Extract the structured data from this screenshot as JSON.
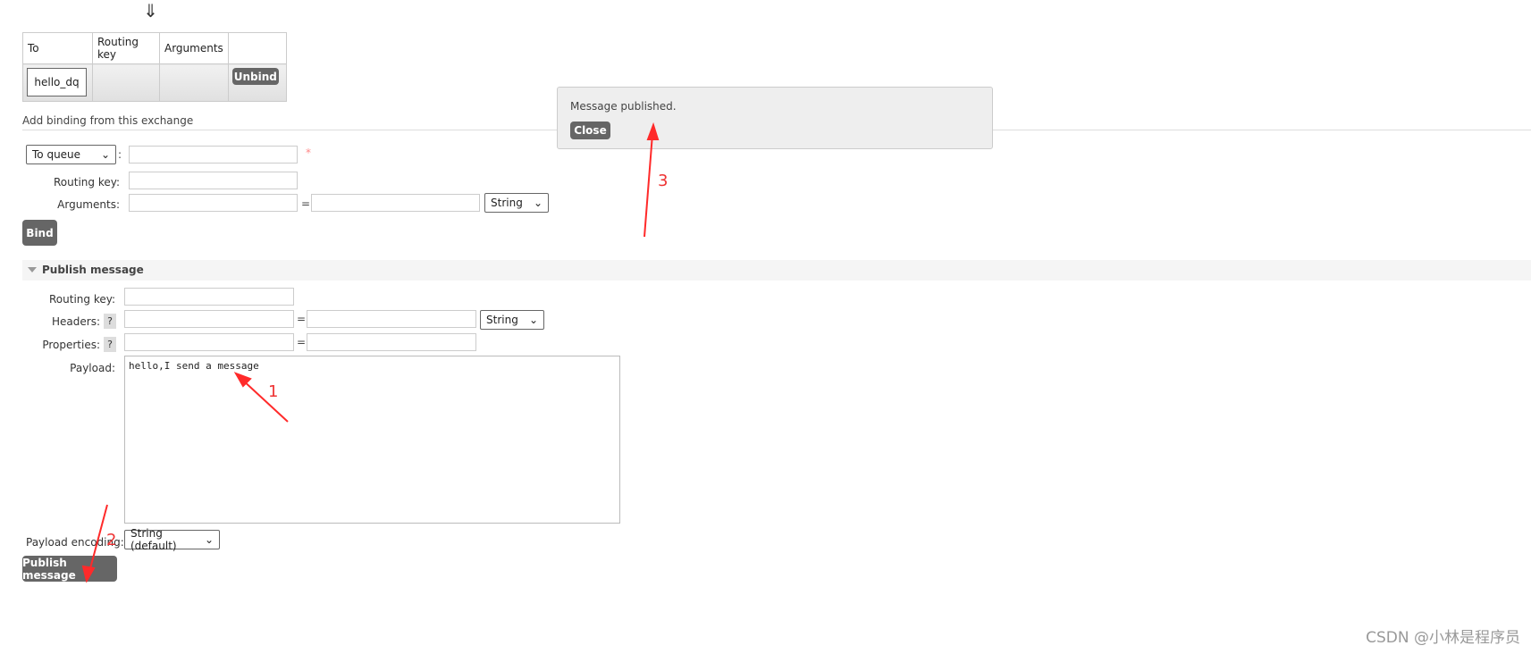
{
  "bindings": {
    "arrow": "⇓",
    "headers": [
      "To",
      "Routing key",
      "Arguments",
      ""
    ],
    "rows": [
      {
        "to": "hello_dq",
        "routing_key": "",
        "arguments": "",
        "action": "Unbind"
      }
    ]
  },
  "add_binding": {
    "title": "Add binding from this exchange",
    "destination_type": "To queue",
    "colon": ":",
    "required_mark": "*",
    "routing_key_label": "Routing key:",
    "arguments_label": "Arguments:",
    "equals": "=",
    "arg_type": "String",
    "bind_label": "Bind"
  },
  "publish": {
    "title": "Publish message",
    "routing_key_label": "Routing key:",
    "headers_label": "Headers:",
    "properties_label": "Properties:",
    "help": "?",
    "equals": "=",
    "header_type": "String",
    "payload_label": "Payload:",
    "payload": "hello,I send a message",
    "encoding_label": "Payload encoding:",
    "encoding": "String (default)",
    "publish_label": "Publish message"
  },
  "toast": {
    "message": "Message published.",
    "close": "Close"
  },
  "annotations": {
    "one": "1",
    "two": "2",
    "three": "3",
    "color": "#ff2a2a"
  },
  "watermark": "CSDN @小林是程序员"
}
